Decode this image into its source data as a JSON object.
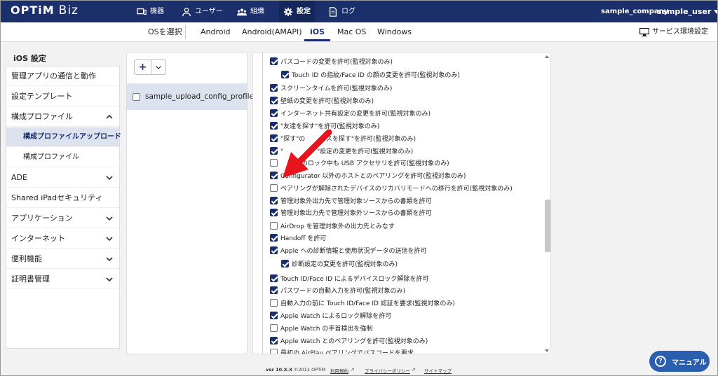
{
  "brand": {
    "logo_main": "OPTiM",
    "logo_sub": "Biz"
  },
  "nav": [
    {
      "label": "機器",
      "icon": "device-icon"
    },
    {
      "label": "ユーザー",
      "icon": "user-icon"
    },
    {
      "label": "組織",
      "icon": "organization-icon"
    },
    {
      "label": "設定",
      "icon": "gear-icon",
      "active": true
    },
    {
      "label": "ログ",
      "icon": "log-icon"
    }
  ],
  "account": {
    "company": "sample_company",
    "user": "sample_user"
  },
  "subnav": {
    "select_os": "OSを選択",
    "tabs": [
      "Android",
      "Android(AMAPI)",
      "iOS",
      "Mac OS",
      "Windows"
    ],
    "active_tab": "iOS",
    "service_settings": "サービス環境設定"
  },
  "sidebar": {
    "title": "iOS 設定",
    "items": [
      {
        "label": "管理アプリの通信と動作"
      },
      {
        "label": "設定テンプレート"
      },
      {
        "label": "構成プロファイル",
        "chevron": "up"
      },
      {
        "label": "構成プロファイルアップロード",
        "sub": true,
        "selected": true
      },
      {
        "label": "構成プロファイル",
        "sub": true
      },
      {
        "label": "ADE",
        "chevron": "down"
      },
      {
        "label": "Shared iPadセキュリティ"
      },
      {
        "label": "アプリケーション",
        "chevron": "down"
      },
      {
        "label": "インターネット",
        "chevron": "down"
      },
      {
        "label": "便利機能",
        "chevron": "down"
      },
      {
        "label": "証明書管理",
        "chevron": "down"
      }
    ]
  },
  "files": {
    "add_label": "+",
    "items": [
      {
        "name": "sample_upload_config_profile",
        "checked": false
      }
    ]
  },
  "options": [
    {
      "label": "パスコードの変更を許可(監視対象のみ)",
      "checked": true,
      "indent": 0
    },
    {
      "label": "Touch ID の指紋/Face ID の顔の変更を許可(監視対象のみ)",
      "checked": true,
      "indent": 1
    },
    {
      "label": "スクリーンタイムを許可(監視対象のみ)",
      "checked": true,
      "indent": 0
    },
    {
      "label": "壁紙の変更を許可(監視対象のみ)",
      "checked": true,
      "indent": 0
    },
    {
      "label": "インターネット共有設定の変更を許可(監視対象のみ)",
      "checked": true,
      "indent": 0
    },
    {
      "label": "\"友達を探す\"を許可(監視対象のみ)",
      "checked": true,
      "indent": 0
    },
    {
      "label": "\"探す\"の　　 イスを探す\"を許可(監視対象のみ)",
      "checked": true,
      "indent": 0
    },
    {
      "label": "\"　 　　　　\"設定の変更を許可(監視対象のみ)",
      "checked": true,
      "indent": 0
    },
    {
      "label": "　　 スのロック中も USB アクセサリを許可(監視対象のみ)",
      "checked": false,
      "indent": 0
    },
    {
      "label": "Configurator 以外のホストとのペアリングを許可(監視対象のみ)",
      "checked": true,
      "indent": 0
    },
    {
      "label": "ペアリングが解除されたデバイスのリカバリモードへの移行を許可(監視対象のみ)",
      "checked": false,
      "indent": 0
    },
    {
      "label": "管理対象外出力先で管理対象ソースからの書類を許可",
      "checked": true,
      "indent": 0
    },
    {
      "label": "管理対象出力先で管理対象外ソースからの書類を許可",
      "checked": true,
      "indent": 0
    },
    {
      "label": "AirDrop を管理対象外の出力先とみなす",
      "checked": false,
      "indent": 0
    },
    {
      "label": "Handoff を許可",
      "checked": true,
      "indent": 0
    },
    {
      "label": "Apple への診断情報と使用状況データの送信を許可",
      "checked": true,
      "indent": 0
    },
    {
      "label": "診断設定の変更を許可(監視対象のみ)",
      "checked": true,
      "indent": 1
    },
    {
      "label": "Touch ID/Face ID によるデバイスロック解除を許可",
      "checked": true,
      "indent": 0
    },
    {
      "label": "パスワードの自動入力を許可(監視対象のみ)",
      "checked": true,
      "indent": 0
    },
    {
      "label": "自動入力の前に Touch ID/Face ID 認証を要求(監視対象のみ)",
      "checked": false,
      "indent": 0
    },
    {
      "label": "Apple Watch によるロック解除を許可",
      "checked": true,
      "indent": 0
    },
    {
      "label": "Apple Watch の手首検出を強制",
      "checked": false,
      "indent": 0
    },
    {
      "label": "Apple Watch とのペアリングを許可(監視対象のみ)",
      "checked": true,
      "indent": 0
    },
    {
      "label": "最初の AirPlay ペアリングでパスコードを要求",
      "checked": false,
      "indent": 0
    }
  ],
  "footer": {
    "version": "ver 10.X.X",
    "copyright": "©2011 OPTiM",
    "terms": "利用規約",
    "privacy": "プライバシーポリシー",
    "sitemap": "サイトマップ"
  },
  "manual_button": "マニュアル",
  "colors": {
    "brand": "#1b2f6b",
    "accent": "#2a5fb0",
    "arrow": "#e8141b"
  }
}
